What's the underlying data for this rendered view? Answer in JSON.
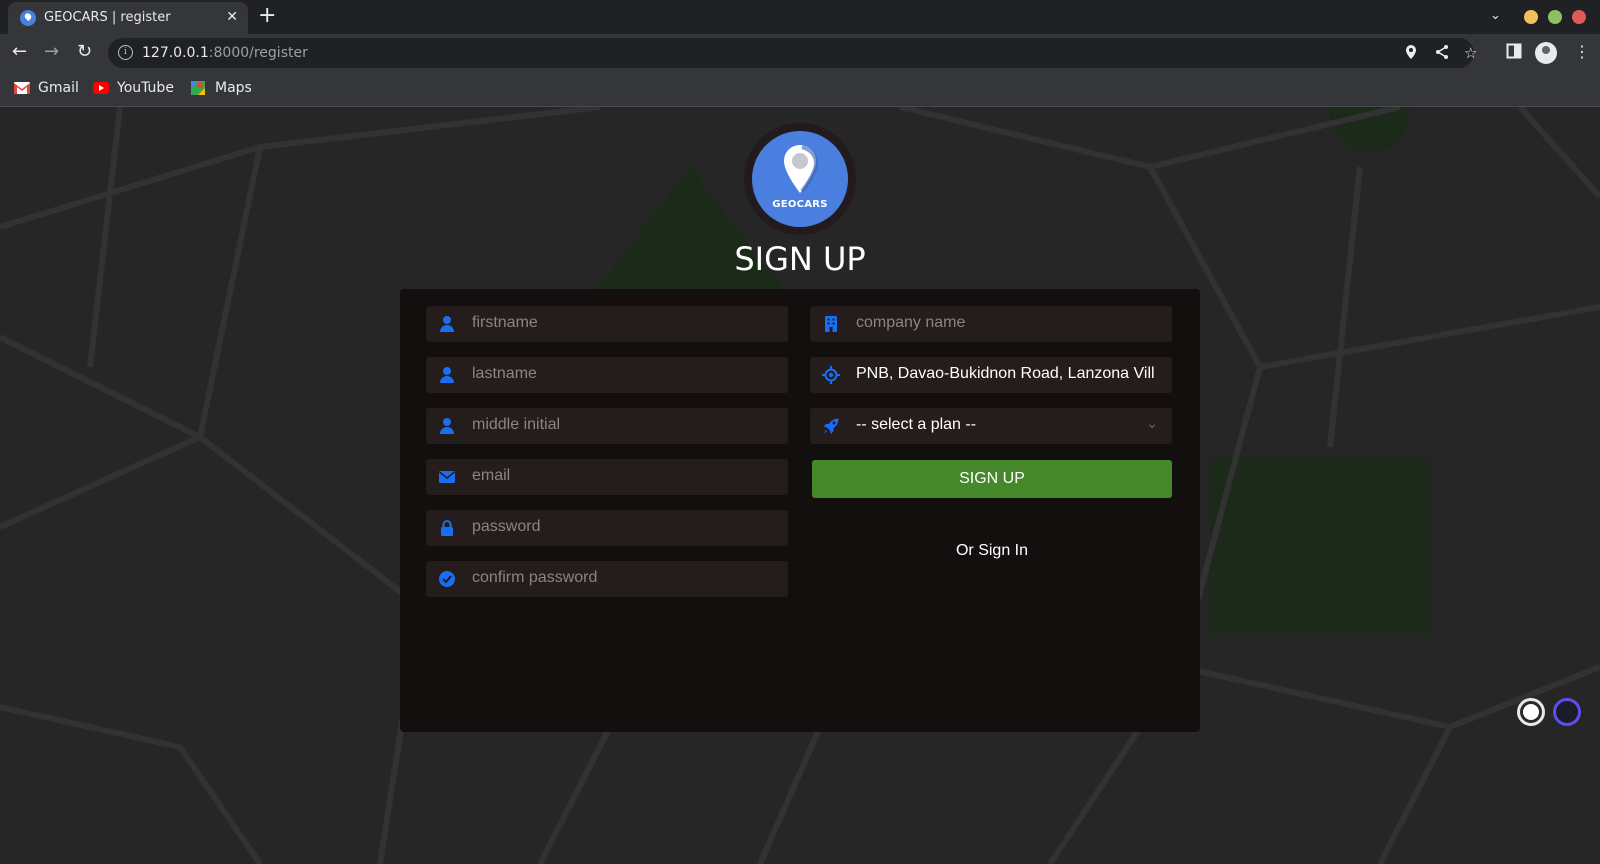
{
  "browser": {
    "tab_title": "GEOCARS | register",
    "tab_close": "✕",
    "new_tab": "+",
    "url_host": "127.0.0.1",
    "url_path": ":8000/register",
    "bookmarks": [
      {
        "label": "Gmail",
        "icon": "gmail-icon",
        "color": "#ea4335"
      },
      {
        "label": "YouTube",
        "icon": "youtube-icon",
        "color": "#ff0000"
      },
      {
        "label": "Maps",
        "icon": "maps-icon",
        "color": "#34a853"
      }
    ]
  },
  "page": {
    "logo_text": "GEOCARS",
    "title": "SIGN UP",
    "fields_left": [
      {
        "placeholder": "firstname",
        "icon": "user-icon"
      },
      {
        "placeholder": "lastname",
        "icon": "user-icon"
      },
      {
        "placeholder": "middle initial",
        "icon": "user-icon"
      },
      {
        "placeholder": "email",
        "icon": "envelope-icon"
      },
      {
        "placeholder": "password",
        "icon": "lock-icon"
      },
      {
        "placeholder": "confirm password",
        "icon": "check-circle-icon"
      }
    ],
    "company_placeholder": "company name",
    "address_value": "PNB, Davao-Bukidnon Road, Lanzona Vill",
    "plan_select": "-- select a plan --",
    "signup_button": "SIGN UP",
    "signin_link": "Or Sign In"
  },
  "colors": {
    "accent_blue": "#1a6ef5",
    "signup_green": "#45882a",
    "logo_blue": "#4a7fe0",
    "card_bg": "#140f0f"
  }
}
